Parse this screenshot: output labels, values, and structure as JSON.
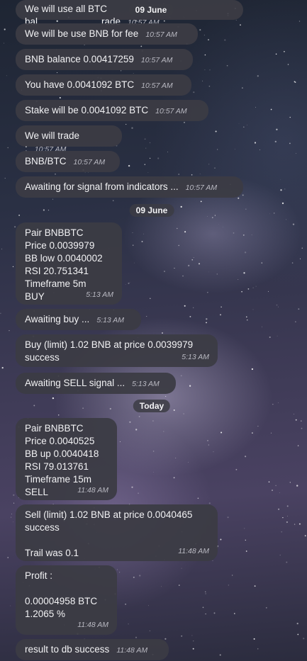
{
  "date_headers": {
    "overlay": "09 June",
    "june": "09 June",
    "today": "Today"
  },
  "messages": [
    {
      "text": "We will use all BTC bal",
      "text_tail": "rade",
      "time": "10:57 AM"
    },
    {
      "text": "We will be use BNB for fee",
      "time": "10:57 AM"
    },
    {
      "text": "BNB balance 0.00417259",
      "time": "10:57 AM"
    },
    {
      "text": "You have 0.0041092 BTC",
      "time": "10:57 AM"
    },
    {
      "text": "Stake will be 0.0041092 BTC",
      "time": "10:57 AM"
    },
    {
      "text": "We will trade :",
      "time": "10:57 AM"
    },
    {
      "text": "BNB/BTC",
      "time": "10:57 AM"
    },
    {
      "text": "Awaiting for signal from indicators ...",
      "time": "10:57 AM"
    },
    {
      "text": "Pair BNBBTC\nPrice 0.0039979\nBB low 0.0040002\nRSI 20.751341\nTimeframe 5m\nBUY",
      "time": "5:13 AM"
    },
    {
      "text": "Awaiting buy ...",
      "time": "5:13 AM"
    },
    {
      "text": "Buy (limit) 1.02 BNB at price 0.0039979\nsuccess",
      "time": "5:13 AM"
    },
    {
      "text": "Awaiting SELL signal ...",
      "time": "5:13 AM"
    },
    {
      "text": "Pair BNBBTC\nPrice 0.0040525\nBB up 0.0040418\nRSI 79.013761\nTimeframe 15m\nSELL",
      "time": "11:48 AM"
    },
    {
      "text": "Sell (limit) 1.02 BNB at price 0.0040465\nsuccess\n\nTrail was 0.1",
      "time": "11:48 AM"
    },
    {
      "text": "Profit :\n\n0.00004958 BTC\n1.2065 %",
      "time": "11:48 AM"
    },
    {
      "text": "result to db success",
      "time": "11:48 AM"
    }
  ]
}
